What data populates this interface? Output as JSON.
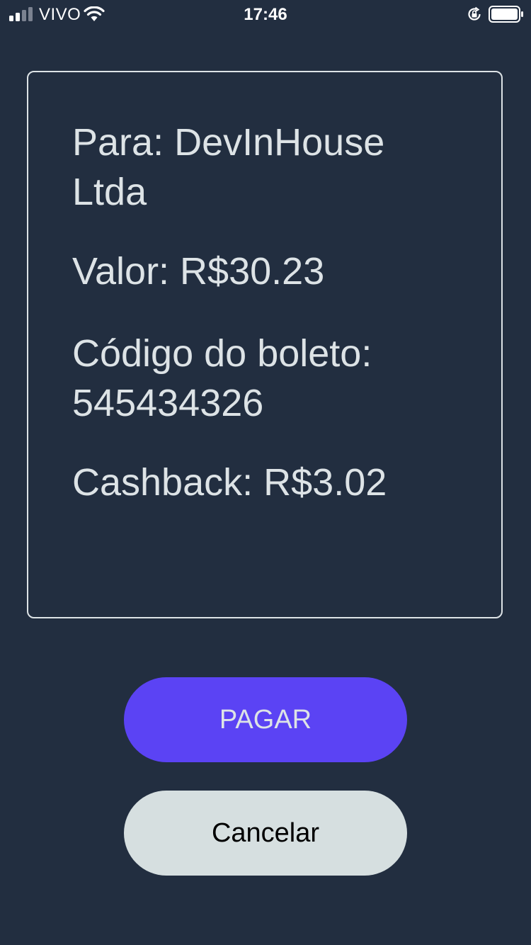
{
  "status_bar": {
    "carrier": "VIVO",
    "time": "17:46"
  },
  "payment": {
    "para": "Para: DevInHouse Ltda",
    "valor": "Valor: R$30.23",
    "codigo": "Código do boleto: 545434326",
    "cashback": "Cashback: R$3.02"
  },
  "actions": {
    "pay_label": "PAGAR",
    "cancel_label": "Cancelar"
  },
  "colors": {
    "background": "#222e40",
    "primary_button": "#5b43f4",
    "secondary_button": "#d6dfe0",
    "text": "#dde3e6"
  },
  "icons": {
    "signal": "signal-bars-icon",
    "wifi": "wifi-icon",
    "rotation_lock": "rotation-lock-icon",
    "battery": "battery-icon"
  }
}
